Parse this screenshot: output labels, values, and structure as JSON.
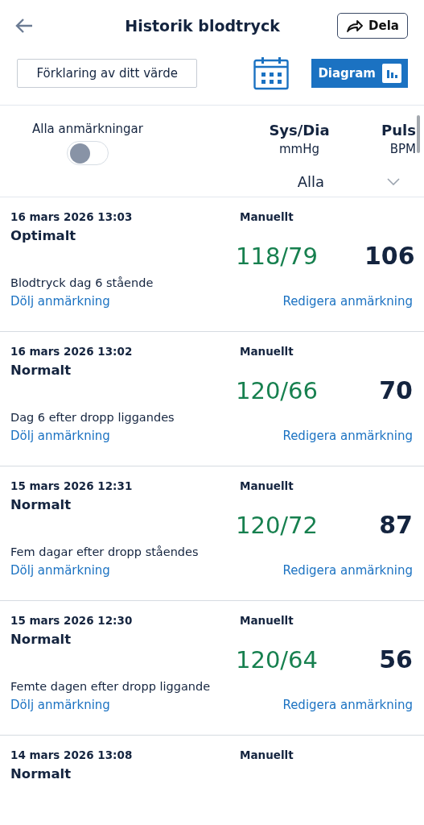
{
  "header": {
    "title": "Historik blodtryck",
    "share_label": "Dela"
  },
  "toolbar": {
    "explain_button": "Förklaring av ditt värde",
    "diagram_button": "Diagram"
  },
  "filter": {
    "toggle_label": "Alla anmärkningar",
    "toggle_on": false,
    "col1_title": "Sys/Dia",
    "col1_unit": "mmHg",
    "col2_title": "Puls",
    "col2_unit": "BPM",
    "select_value": "Alla"
  },
  "entries": [
    {
      "date": "16 mars 2026 13:03",
      "source": "Manuellt",
      "status": "Optimalt",
      "pressure": "118/79",
      "pulse": "106",
      "note": "Blodtryck dag 6 stående",
      "hide_link": "Dölj anmärkning",
      "edit_link": "Redigera anmärkning"
    },
    {
      "date": "16 mars 2026 13:02",
      "source": "Manuellt",
      "status": "Normalt",
      "pressure": "120/66",
      "pulse": "70",
      "note": "Dag 6 efter dropp liggandes",
      "hide_link": "Dölj anmärkning",
      "edit_link": "Redigera anmärkning"
    },
    {
      "date": "15 mars 2026 12:31",
      "source": "Manuellt",
      "status": "Normalt",
      "pressure": "120/72",
      "pulse": "87",
      "note": "Fem dagar efter dropp ståendes",
      "hide_link": "Dölj anmärkning",
      "edit_link": "Redigera anmärkning"
    },
    {
      "date": "15 mars 2026 12:30",
      "source": "Manuellt",
      "status": "Normalt",
      "pressure": "120/64",
      "pulse": "56",
      "note": "Femte dagen efter dropp liggande",
      "hide_link": "Dölj anmärkning",
      "edit_link": "Redigera anmärkning"
    },
    {
      "date": "14 mars 2026 13:08",
      "source": "Manuellt",
      "status": "Normalt"
    }
  ]
}
